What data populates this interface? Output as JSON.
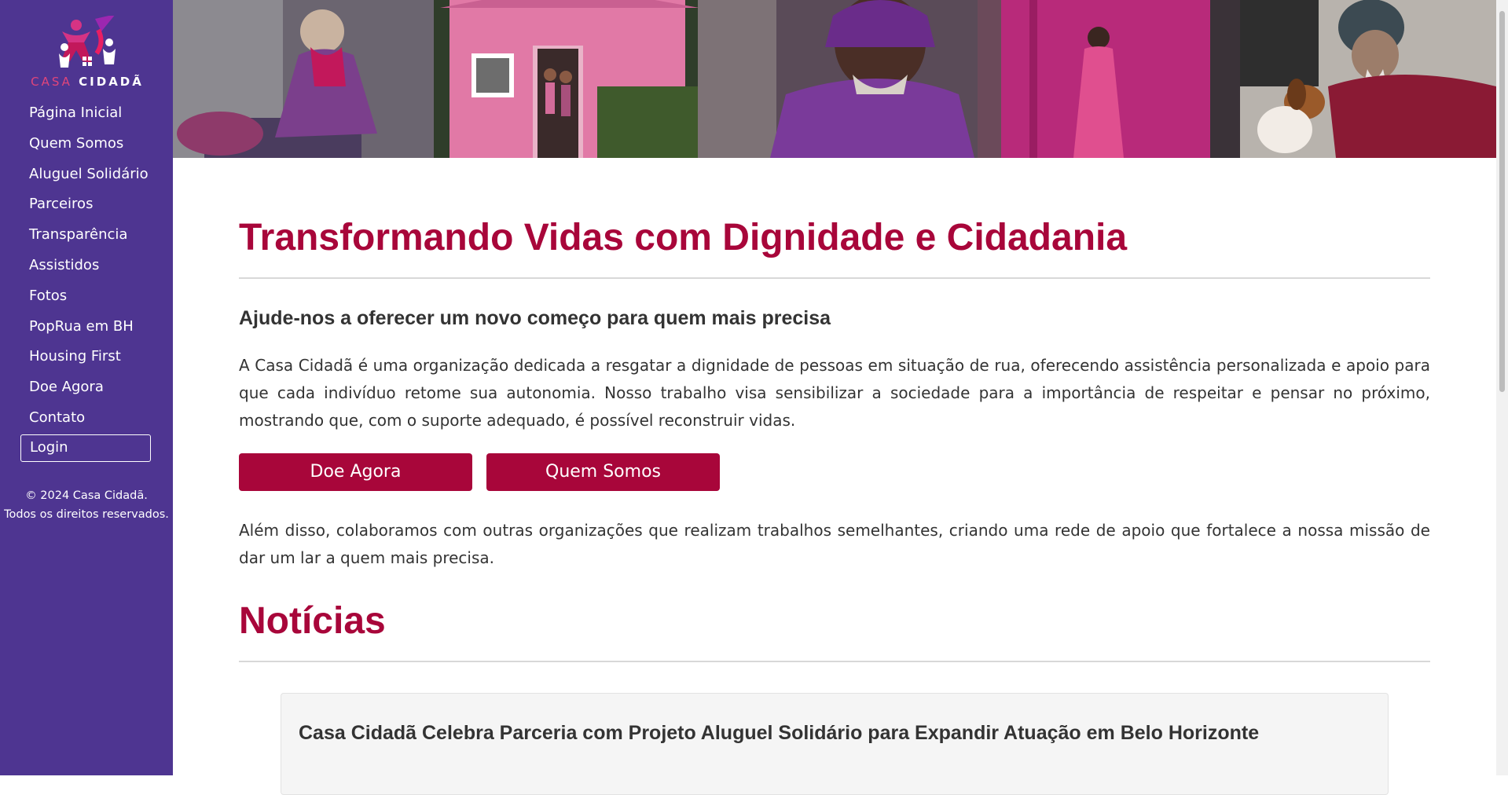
{
  "brand": {
    "name_part1": "CASA",
    "name_part2": "CIDADÃ"
  },
  "nav": {
    "items": [
      "Página Inicial",
      "Quem Somos",
      "Aluguel Solidário",
      "Parceiros",
      "Transparência",
      "Assistidos",
      "Fotos",
      "PopRua em BH",
      "Housing First",
      "Doe Agora",
      "Contato"
    ],
    "login_label": "Login"
  },
  "footer": {
    "copyright_line1": "© 2024 Casa Cidadã.",
    "copyright_line2": "Todos os direitos reservados."
  },
  "hero": {
    "title": "Transformando Vidas com Dignidade e Cidadania",
    "subtitle": "Ajude-nos a oferecer um novo começo para quem mais precisa",
    "paragraph1": "A Casa Cidadã é uma organização dedicada a resgatar a dignidade de pessoas em situação de rua, oferecendo assistência personalizada e apoio para que cada indivíduo retome sua autonomia. Nosso trabalho visa sensibilizar a sociedade para a importância de respeitar e pensar no próximo, mostrando que, com o suporte adequado, é possível reconstruir vidas.",
    "donate_button": "Doe Agora",
    "about_button": "Quem Somos",
    "paragraph2": "Além disso, colaboramos com outras organizações que realizam trabalhos semelhantes, criando uma rede de apoio que fortalece a nossa missão de dar um lar a quem mais precisa."
  },
  "news": {
    "title": "Notícias",
    "items": [
      {
        "headline": "Casa Cidadã Celebra Parceria com Projeto Aluguel Solidário para Expandir Atuação em Belo Horizonte"
      }
    ]
  },
  "colors": {
    "sidebar": "#4e3591",
    "accent": "#a8063a",
    "logo_pink": "#e0457b"
  },
  "icons": [
    "casa-cidada-logo",
    "banner-photo-collage"
  ]
}
